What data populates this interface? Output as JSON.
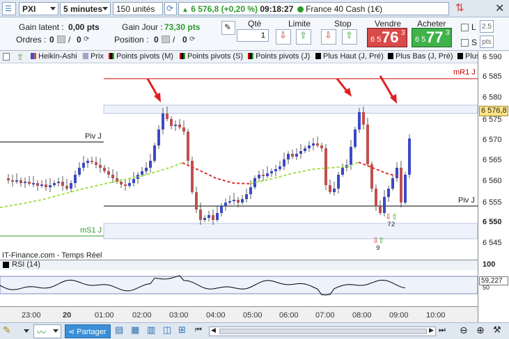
{
  "toolbar": {
    "symbol": "PXI",
    "timeframe": "5 minutes",
    "units": "150 unités",
    "last_price": "6 576,8",
    "change": "(+0,20 %)",
    "time": "09:18:27",
    "instrument": "France 40 Cash (1€)"
  },
  "info": {
    "gain_latent_label": "Gain latent :",
    "gain_latent_value": "0,00 pts",
    "gain_jour_label": "Gain Jour :",
    "gain_jour_value": "73,30 pts",
    "ordres_label": "Ordres :",
    "ordres_value": "0",
    "ordres_count": "0",
    "position_label": "Position :",
    "position_value": "0",
    "position_count": "0",
    "qte_label": "Qté",
    "qte_value": "1",
    "limite_label": "Limite",
    "stop_label": "Stop",
    "vendre_label": "Vendre",
    "vendre_small": "6 5",
    "vendre_big": "76",
    "vendre_sup": "3",
    "acheter_label": "Acheter",
    "acheter_small": "6 5",
    "acheter_big": "77",
    "acheter_sup": "3",
    "l_label": "L",
    "l_value": "2.5",
    "s_label": "S",
    "s_value": "pts"
  },
  "indicators": [
    "Heikin-Ashi",
    "Prix",
    "Points pivots (M)",
    "Points pivots (S)",
    "Points pivots (J)",
    "Plus Haut (J, Pré)",
    "Plus Bas (J, Pré)",
    "Plus"
  ],
  "chart": {
    "levels": {
      "mr1": "mR1 J",
      "piv_left": "Piv J",
      "piv_right": "Piv J",
      "ms1": "mS1 J"
    },
    "annotations": {
      "count1": "72",
      "count2": "9"
    },
    "source": "IT-Finance.com - Temps Réel",
    "price_badge": "6 576,8",
    "y_ticks": [
      "6 590",
      "6 585",
      "6 580",
      "6 575",
      "6 570",
      "6 565",
      "6 560",
      "6 555",
      "6 550",
      "6 545"
    ],
    "colors": {
      "up": "#3b49c8",
      "down": "#c0504d",
      "pivot": "#000000",
      "mr1": "#cc0000",
      "ms1": "#2e9a2e",
      "ma_up": "#a6e04a",
      "ma_down": "#e03030",
      "badge": "#ffe58a"
    }
  },
  "rsi": {
    "label": "RSI (14)",
    "top_tick": "100",
    "value": "59,227",
    "ref": "50"
  },
  "time_axis": [
    "23:00",
    "20",
    "01:00",
    "02:00",
    "03:00",
    "04:00",
    "05:00",
    "06:00",
    "07:00",
    "08:00",
    "09:00",
    "10:00"
  ],
  "bottom": {
    "share_label": "Partager"
  }
}
